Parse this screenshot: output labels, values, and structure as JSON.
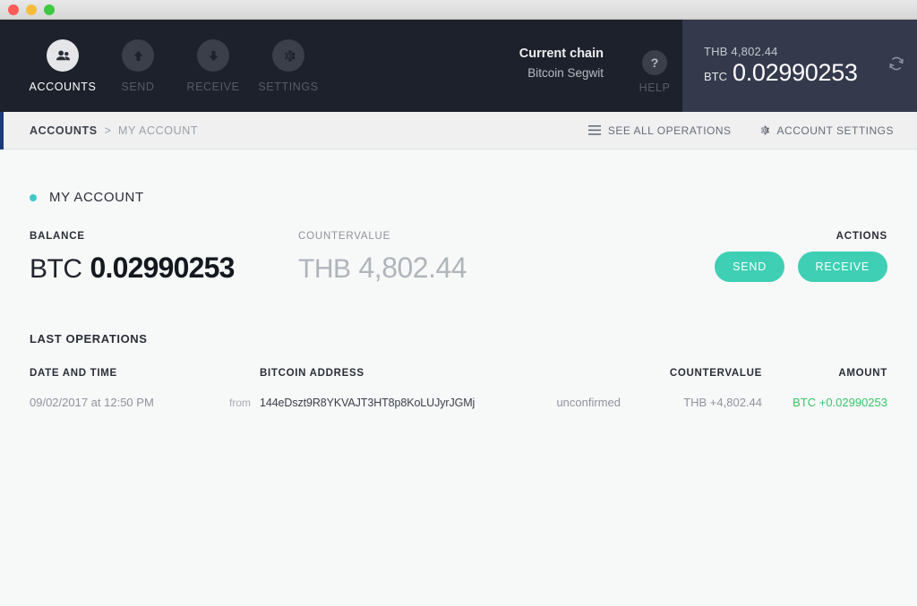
{
  "window": {
    "controls": [
      "close",
      "minimize",
      "maximize"
    ]
  },
  "header": {
    "nav": [
      {
        "id": "accounts",
        "label": "ACCOUNTS",
        "icon": "people-icon",
        "active": true
      },
      {
        "id": "send",
        "label": "SEND",
        "icon": "arrow-up-icon",
        "active": false
      },
      {
        "id": "receive",
        "label": "RECEIVE",
        "icon": "arrow-down-icon",
        "active": false
      },
      {
        "id": "settings",
        "label": "SETTINGS",
        "icon": "gear-icon",
        "active": false
      }
    ],
    "chain": {
      "label": "Current chain",
      "value": "Bitcoin Segwit"
    },
    "help": {
      "label": "HELP",
      "icon": "question-mark-icon"
    },
    "totals": {
      "fiat_currency": "THB",
      "fiat_amount": "4,802.44",
      "fiat_line": "THB 4,802.44",
      "crypto_currency": "BTC",
      "crypto_amount": "0.02990253",
      "refresh_icon": "sync-icon"
    },
    "colors": {
      "background": "#1d212b",
      "totals_background": "#343a4c",
      "active_underline": "#ee3f5c"
    }
  },
  "breadcrumb": {
    "root": "ACCOUNTS",
    "separator": ">",
    "current": "MY ACCOUNT",
    "actions": [
      {
        "id": "see-all-operations",
        "label": "SEE ALL OPERATIONS",
        "icon": "hamburger-icon"
      },
      {
        "id": "account-settings",
        "label": "ACCOUNT SETTINGS",
        "icon": "gear-icon"
      }
    ]
  },
  "account": {
    "name": "MY ACCOUNT",
    "status_color": "#41c8c8",
    "balance": {
      "header": "BALANCE",
      "unit": "BTC",
      "amount": "0.02990253"
    },
    "countervalue": {
      "header": "COUNTERVALUE",
      "unit": "THB",
      "amount": "4,802.44"
    },
    "actions": {
      "header": "ACTIONS",
      "send_label": "SEND",
      "receive_label": "RECEIVE",
      "button_color": "#3ecfb4"
    }
  },
  "operations": {
    "title": "LAST OPERATIONS",
    "columns": {
      "date": "DATE AND TIME",
      "address": "BITCOIN ADDRESS",
      "countervalue": "COUNTERVALUE",
      "amount": "AMOUNT"
    },
    "rows": [
      {
        "date": "09/02/2017 at 12:50 PM",
        "direction": "from",
        "address": "144eDszt9R8YKVAJT3HT8p8KoLUJyrJGMj",
        "status": "unconfirmed",
        "countervalue": "THB +4,802.44",
        "amount": "BTC +0.02990253",
        "amount_color": "#3ac569"
      }
    ]
  }
}
